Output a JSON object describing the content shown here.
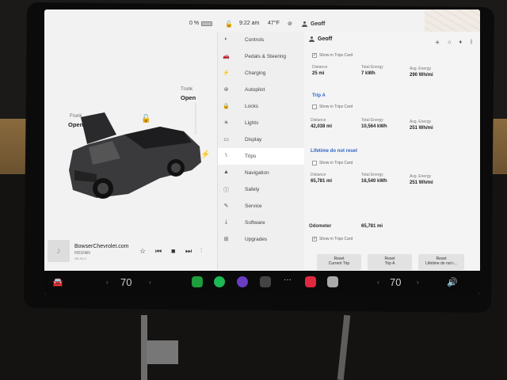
{
  "status": {
    "battery": "0 %",
    "time": "9:22 am",
    "temp": "47°F",
    "user": "Geoff"
  },
  "car": {
    "frunk_label": "Frunk",
    "frunk_state": "Open",
    "trunk_label": "Trunk",
    "trunk_state": "Open"
  },
  "media": {
    "station": "BowserChevrolet.com",
    "freq": "HD1FAN",
    "hd": "HD 91.0"
  },
  "menu": {
    "items": [
      {
        "label": "Controls",
        "icon": "toggle-icon"
      },
      {
        "label": "Pedals & Steering",
        "icon": "car-icon"
      },
      {
        "label": "Charging",
        "icon": "bolt-icon"
      },
      {
        "label": "Autopilot",
        "icon": "steering-icon"
      },
      {
        "label": "Locks",
        "icon": "lock-icon"
      },
      {
        "label": "Lights",
        "icon": "light-icon"
      },
      {
        "label": "Display",
        "icon": "display-icon"
      },
      {
        "label": "Trips",
        "icon": "trips-icon"
      },
      {
        "label": "Navigation",
        "icon": "navigation-icon"
      },
      {
        "label": "Safety",
        "icon": "safety-icon"
      },
      {
        "label": "Service",
        "icon": "wrench-icon"
      },
      {
        "label": "Software",
        "icon": "download-icon"
      },
      {
        "label": "Upgrades",
        "icon": "bag-icon"
      }
    ]
  },
  "trips": {
    "user": "Geoff",
    "show_in_trips_card": "Show in Trips Card",
    "since_last_charge": {
      "distance_label": "Distance",
      "distance": "25 mi",
      "energy_label": "Total Energy",
      "energy": "7 kWh",
      "avg_label": "Avg. Energy",
      "avg": "290 Wh/mi"
    },
    "trip_a": {
      "title": "Trip A",
      "show": "Show in Trips Card",
      "distance_label": "Distance",
      "distance": "42,038 mi",
      "energy_label": "Total Energy",
      "energy": "10,564 kWh",
      "avg_label": "Avg. Energy",
      "avg": "251 Wh/mi"
    },
    "lifetime": {
      "title": "Lifetime do not reset",
      "show": "Show in Trips Card",
      "distance_label": "Distance",
      "distance": "65,781 mi",
      "energy_label": "Total Energy",
      "energy": "16,540 kWh",
      "avg_label": "Avg. Energy",
      "avg": "251 Wh/mi"
    },
    "odometer_label": "Odometer",
    "odometer": "65,781 mi",
    "odo_show": "Show in Trips Card",
    "reset_current_1": "Reset",
    "reset_current_2": "Current Trip",
    "reset_a_1": "Reset",
    "reset_a_2": "Trip A",
    "reset_life_1": "Reset",
    "reset_life_2": "Lifetime do not r..."
  },
  "bottom": {
    "driver_temp": "70",
    "passenger_temp": "70"
  }
}
